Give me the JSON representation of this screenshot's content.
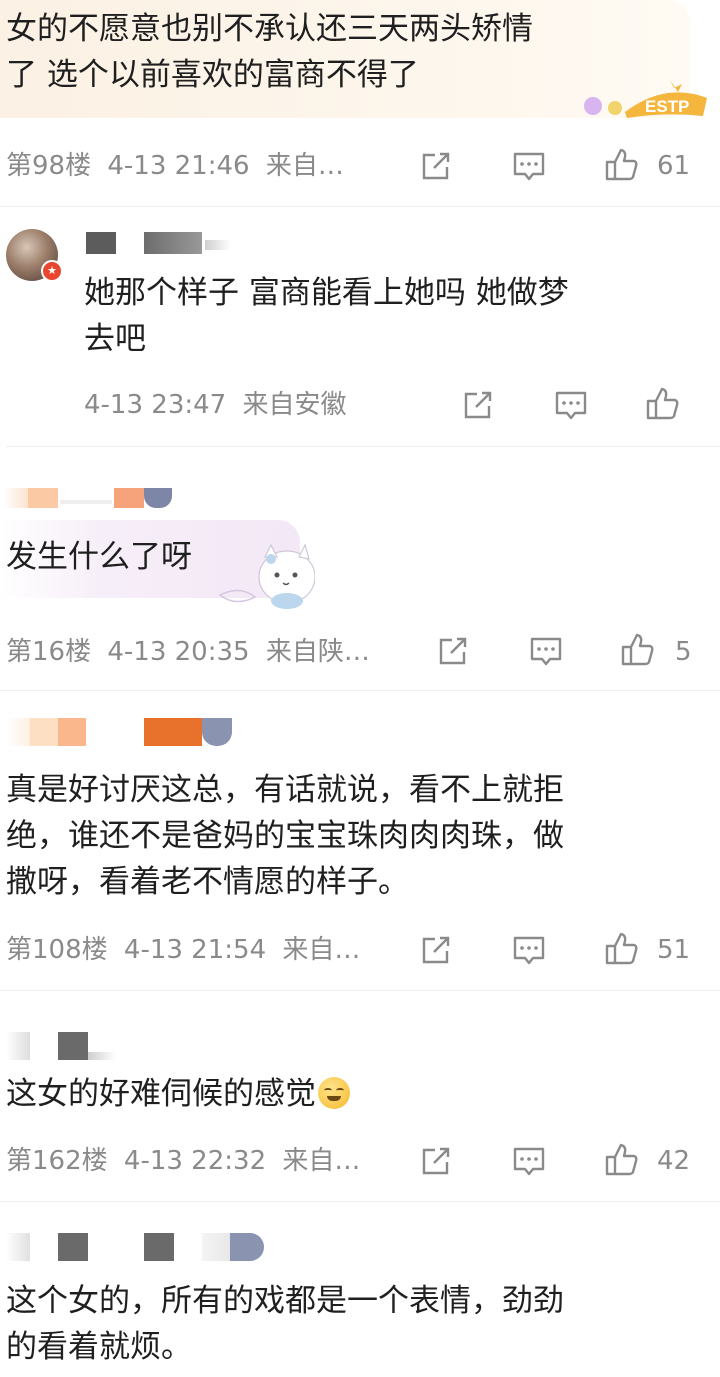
{
  "comments": [
    {
      "lines": [
        "女的不愿意也别不承认还三天两头矫情",
        "了 选个以前喜欢的富商不得了"
      ],
      "floor": "第98楼",
      "date": "4-13 21:46",
      "from": "来自…",
      "likes": "61",
      "sticker": "ESTP"
    },
    {
      "lines": [
        "她那个样子 富商能看上她吗 她做梦",
        "去吧"
      ],
      "floor": "",
      "date": "4-13 23:47",
      "from": "来自安徽",
      "likes": ""
    },
    {
      "lines": [
        "发生什么了呀"
      ],
      "floor": "第16楼",
      "date": "4-13 20:35",
      "from": "来自陕…",
      "likes": "5"
    },
    {
      "lines": [
        "真是好讨厌这总，有话就说，看不上就拒",
        "绝，谁还不是爸妈的宝宝珠肉肉肉珠，做",
        "撒呀，看着老不情愿的样子。"
      ],
      "floor": "第108楼",
      "date": "4-13 21:54",
      "from": "来自…",
      "likes": "51"
    },
    {
      "lines": [
        "这女的好难伺候的感觉"
      ],
      "floor": "第162楼",
      "date": "4-13 22:32",
      "from": "来自…",
      "likes": "42"
    },
    {
      "lines": [
        "这个女的，所有的戏都是一个表情，劲劲",
        "的看着就烦。"
      ]
    }
  ],
  "colors": {
    "meta_text": "#8a8a8a",
    "body_text": "#1f1f1f",
    "divider": "#eeeeee",
    "bubble_gold": "#fdf4e6",
    "bubble_purple": "#f6eef8"
  },
  "icons": [
    "share-icon",
    "comment-icon",
    "like-icon",
    "laughing-emoji-icon"
  ]
}
